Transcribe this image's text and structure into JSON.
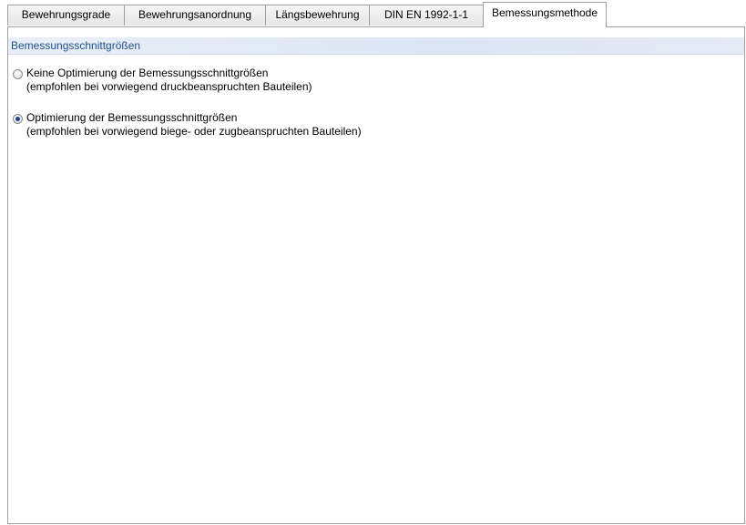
{
  "tabs": [
    {
      "label": "Bewehrungsgrade",
      "active": false
    },
    {
      "label": "Bewehrungsanordnung",
      "active": false
    },
    {
      "label": "Längsbewehrung",
      "active": false
    },
    {
      "label": "DIN EN 1992-1-1",
      "active": false
    },
    {
      "label": "Bemessungsmethode",
      "active": true
    }
  ],
  "group": {
    "title": "Bemessungsschnittgrößen"
  },
  "options": [
    {
      "label": "Keine Optimierung der Bemessungsschnittgrößen",
      "hint": "(empfohlen bei vorwiegend druckbeanspruchten Bauteilen)",
      "selected": false
    },
    {
      "label": "Optimierung der Bemessungsschnittgrößen",
      "hint": "(empfohlen bei vorwiegend biege- oder zugbeanspruchten Bauteilen)",
      "selected": true
    }
  ],
  "colors": {
    "group_header_text": "#1e4f8f",
    "group_header_bg": "#dde6f3",
    "radio_dot": "#1f3e8a"
  }
}
